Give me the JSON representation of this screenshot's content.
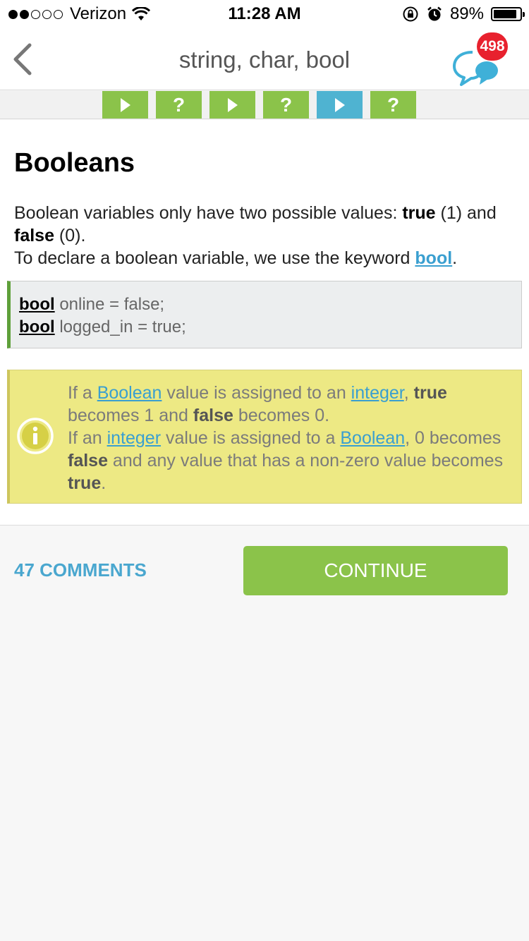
{
  "status_bar": {
    "carrier": "Verizon",
    "time": "11:28 AM",
    "battery_percent": "89%",
    "battery_level": 0.89,
    "icons": [
      "signal-dots-icon",
      "wifi-icon",
      "rotation-lock-icon",
      "alarm-icon",
      "battery-icon"
    ]
  },
  "nav": {
    "title": "string, char, bool",
    "badge_count": "498",
    "back_icon": "chevron-left-icon",
    "chat_icon": "chat-bubbles-icon"
  },
  "progress": {
    "steps": [
      {
        "type": "lesson",
        "label": ""
      },
      {
        "type": "quiz",
        "label": "?"
      },
      {
        "type": "lesson",
        "label": ""
      },
      {
        "type": "quiz",
        "label": "?"
      },
      {
        "type": "lesson",
        "label": "",
        "active": true
      },
      {
        "type": "quiz",
        "label": "?"
      }
    ],
    "colors": {
      "done": "#8bc34a",
      "active": "#4fb3d1"
    }
  },
  "lesson": {
    "heading": "Booleans",
    "p1_a": "Boolean variables only have two possible values: ",
    "p1_true": "true",
    "p1_b": " (1) and ",
    "p1_false": "false",
    "p1_c": " (0).",
    "p2_a": "To declare a boolean variable, we use the keyword ",
    "p2_link": "bool",
    "p2_b": ".",
    "code": [
      {
        "kw": "bool",
        "rest": " online = false;"
      },
      {
        "kw": "bool",
        "rest": " logged_in = true;"
      }
    ],
    "note": {
      "t1": "If a ",
      "l1": "Boolean",
      "t2": " value is assigned to an ",
      "l2": "integer",
      "t3": ", ",
      "b1": "true",
      "t4": " becomes 1 and ",
      "b2": "false",
      "t5": " becomes 0.",
      "t6": "If an ",
      "l3": "integer",
      "t7": " value is assigned to a ",
      "l4": "Boolean",
      "t8": ", 0 becomes ",
      "b3": "false",
      "t9": " and any value that has a non-zero value becomes ",
      "b4": "true",
      "t10": ".",
      "icon": "info-icon"
    }
  },
  "footer": {
    "comments_label": "47 COMMENTS",
    "continue_label": "CONTINUE"
  },
  "colors": {
    "accent_green": "#8bc34a",
    "accent_blue": "#4fb3d1",
    "link": "#3a9fd0",
    "badge_red": "#e8212e",
    "note_bg": "#ede984"
  }
}
